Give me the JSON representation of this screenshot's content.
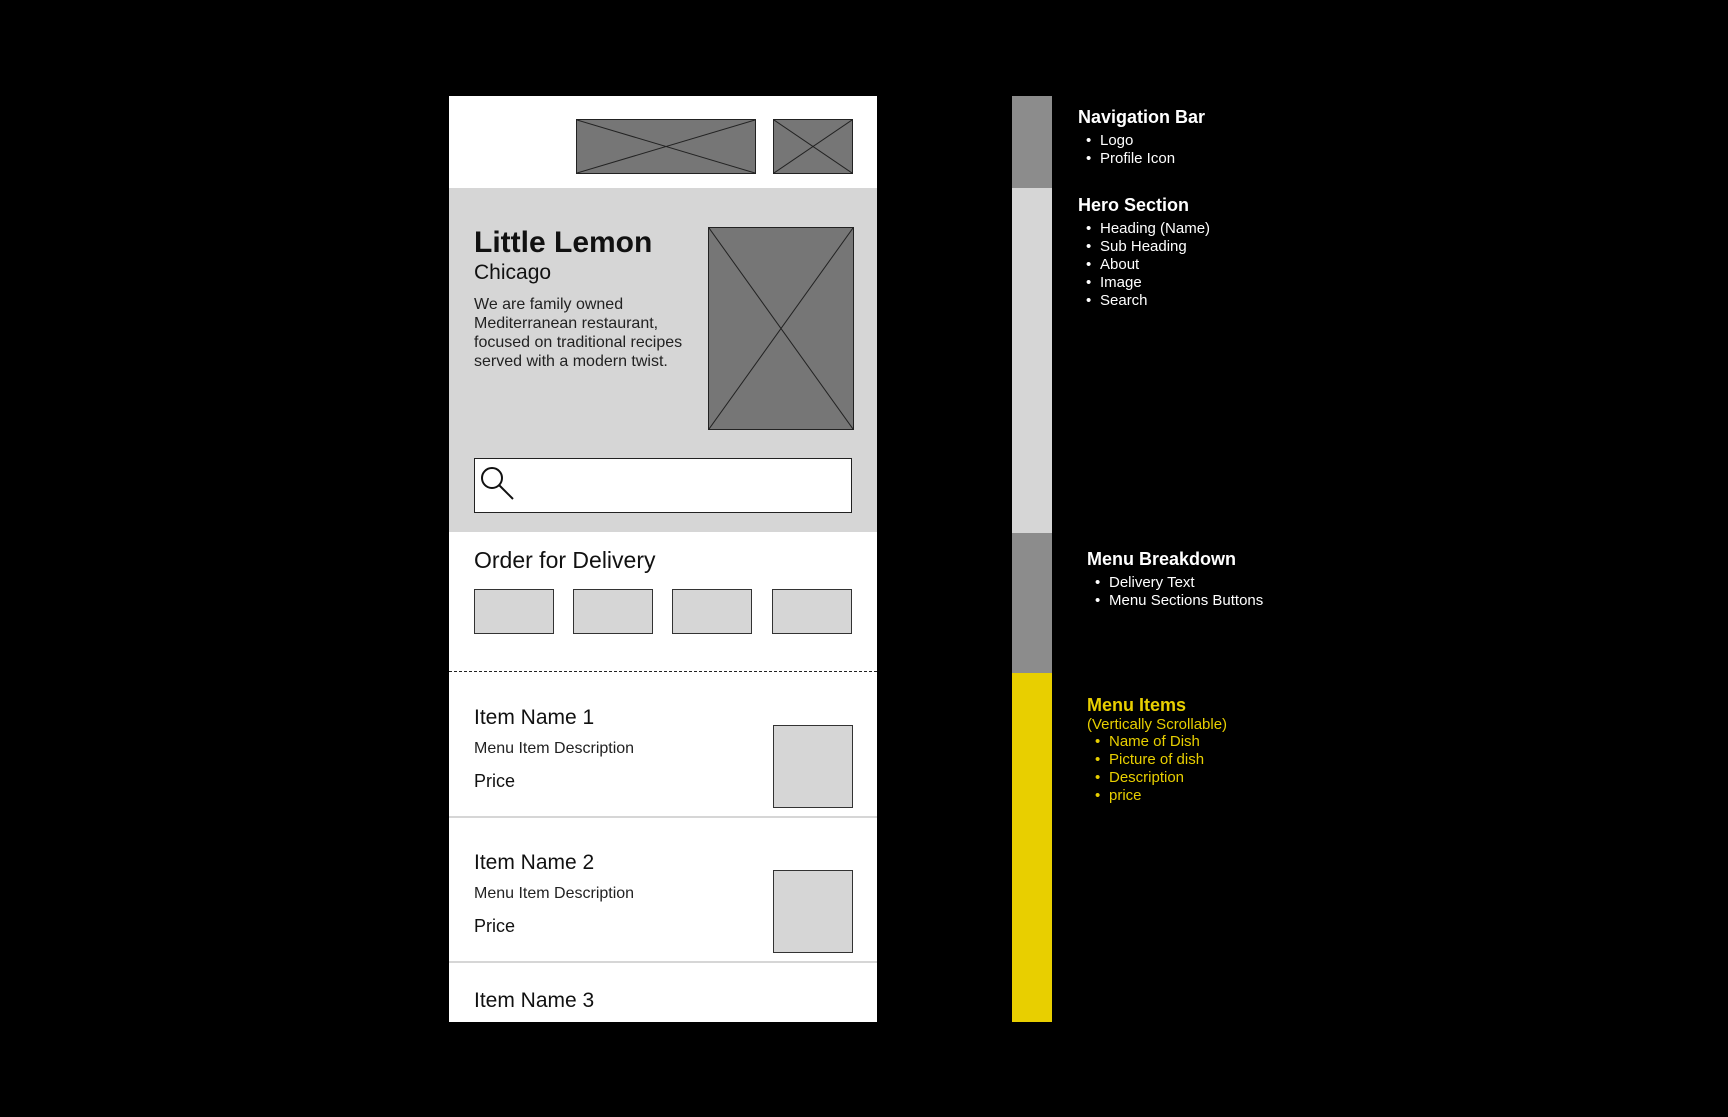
{
  "hero": {
    "title": "Little Lemon",
    "subtitle": "Chicago",
    "about": "We are family owned Mediterranean restaurant, focused on traditional recipes served with a modern twist."
  },
  "delivery": {
    "title": "Order for Delivery"
  },
  "menu_items": [
    {
      "name": "Item Name 1",
      "description": "Menu Item Description",
      "price": "Price"
    },
    {
      "name": "Item Name 2",
      "description": "Menu Item Description",
      "price": "Price"
    },
    {
      "name": "Item Name 3"
    }
  ],
  "annotations": {
    "nav": {
      "title": "Navigation Bar",
      "items": [
        "Logo",
        "Profile Icon"
      ]
    },
    "hero": {
      "title": "Hero Section",
      "items": [
        "Heading (Name)",
        "Sub Heading",
        "About",
        "Image",
        "Search"
      ]
    },
    "breakdown": {
      "title": "Menu Breakdown",
      "items": [
        "Delivery Text",
        "Menu Sections Buttons"
      ]
    },
    "menu_items": {
      "title": "Menu Items",
      "note": "(Vertically Scrollable)",
      "items": [
        "Name of Dish",
        "Picture of dish",
        "Description",
        "price"
      ]
    }
  },
  "colors": {
    "bar_dark": "#8c8c8c",
    "bar_light": "#d6d6d6",
    "bar_accent": "#e8cf00",
    "placeholder": "#767676"
  },
  "icons": {
    "search": "magnifier-icon"
  }
}
